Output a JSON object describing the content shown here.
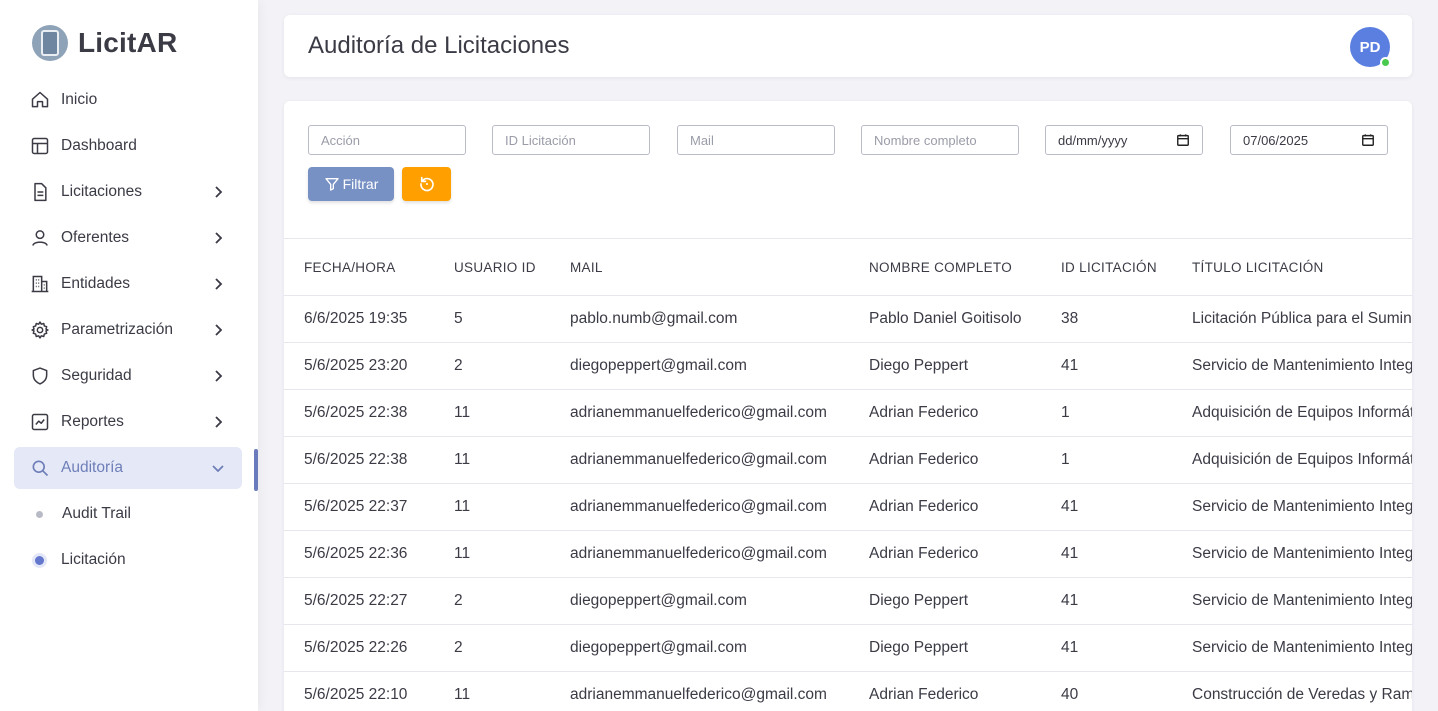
{
  "brand": {
    "name": "LicitAR"
  },
  "sidebar": {
    "items": [
      {
        "label": "Inicio",
        "icon": "home-icon",
        "expandable": false
      },
      {
        "label": "Dashboard",
        "icon": "dashboard-icon",
        "expandable": false
      },
      {
        "label": "Licitaciones",
        "icon": "document-icon",
        "expandable": true
      },
      {
        "label": "Oferentes",
        "icon": "user-icon",
        "expandable": true
      },
      {
        "label": "Entidades",
        "icon": "building-icon",
        "expandable": true
      },
      {
        "label": "Parametrización",
        "icon": "gear-icon",
        "expandable": true
      },
      {
        "label": "Seguridad",
        "icon": "shield-icon",
        "expandable": true
      },
      {
        "label": "Reportes",
        "icon": "chart-icon",
        "expandable": true
      },
      {
        "label": "Auditoría",
        "icon": "search-icon",
        "expandable": true,
        "active": true
      }
    ],
    "subitems": [
      {
        "label": "Audit Trail"
      },
      {
        "label": "Licitación",
        "selected": true
      }
    ]
  },
  "header": {
    "title": "Auditoría de Licitaciones",
    "avatar_initials": "PD"
  },
  "filters": {
    "accion_placeholder": "Acción",
    "id_placeholder": "ID Licitación",
    "mail_placeholder": "Mail",
    "nombre_placeholder": "Nombre completo",
    "date_from": "dd/mm/yyyy",
    "date_to": "07/06/2025",
    "filter_label": "Filtrar"
  },
  "table": {
    "columns": [
      "FECHA/HORA",
      "USUARIO ID",
      "MAIL",
      "NOMBRE COMPLETO",
      "ID LICITACIÓN",
      "TÍTULO LICITACIÓN"
    ],
    "rows": [
      [
        "6/6/2025 19:35",
        "5",
        "pablo.numb@gmail.com",
        "Pablo Daniel Goitisolo",
        "38",
        "Licitación Pública para el Sumin"
      ],
      [
        "5/6/2025 23:20",
        "2",
        "diegopeppert@gmail.com",
        "Diego Peppert",
        "41",
        "Servicio de Mantenimiento Integ"
      ],
      [
        "5/6/2025 22:38",
        "11",
        "adrianemmanuelfederico@gmail.com",
        "Adrian Federico",
        "1",
        "Adquisición de Equipos Informát"
      ],
      [
        "5/6/2025 22:38",
        "11",
        "adrianemmanuelfederico@gmail.com",
        "Adrian Federico",
        "1",
        "Adquisición de Equipos Informát"
      ],
      [
        "5/6/2025 22:37",
        "11",
        "adrianemmanuelfederico@gmail.com",
        "Adrian Federico",
        "41",
        "Servicio de Mantenimiento Integ"
      ],
      [
        "5/6/2025 22:36",
        "11",
        "adrianemmanuelfederico@gmail.com",
        "Adrian Federico",
        "41",
        "Servicio de Mantenimiento Integ"
      ],
      [
        "5/6/2025 22:27",
        "2",
        "diegopeppert@gmail.com",
        "Diego Peppert",
        "41",
        "Servicio de Mantenimiento Integ"
      ],
      [
        "5/6/2025 22:26",
        "2",
        "diegopeppert@gmail.com",
        "Diego Peppert",
        "41",
        "Servicio de Mantenimiento Integ"
      ],
      [
        "5/6/2025 22:10",
        "11",
        "adrianemmanuelfederico@gmail.com",
        "Adrian Federico",
        "40",
        "Construcción de Veredas y Ram"
      ]
    ]
  },
  "colors": {
    "accent": "#6a7bbd",
    "filter_button": "#7891c4",
    "reset_button": "#ffa000",
    "avatar": "#5b7fe0",
    "online": "#49c94d"
  }
}
